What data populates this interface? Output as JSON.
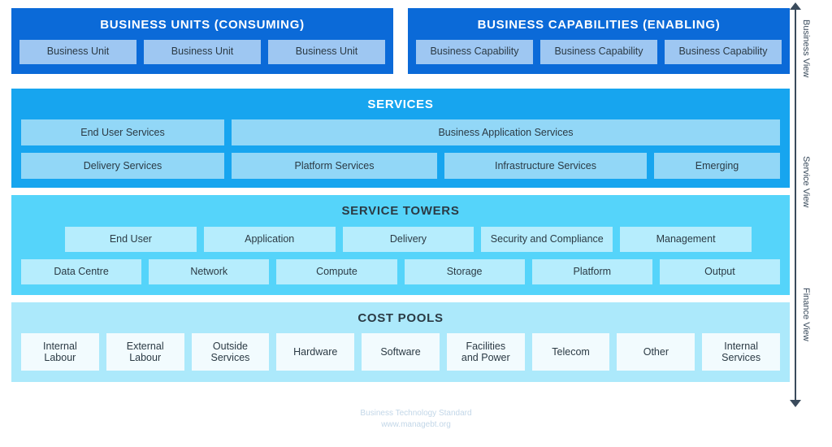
{
  "business_units": {
    "title": "BUSINESS UNITS (CONSUMING)",
    "tiles": [
      "Business Unit",
      "Business Unit",
      "Business Unit"
    ]
  },
  "business_capabilities": {
    "title": "BUSINESS CAPABILITIES (ENABLING)",
    "tiles": [
      "Business Capability",
      "Business Capability",
      "Business Capability"
    ]
  },
  "services": {
    "title": "SERVICES",
    "row1": [
      "End User Services",
      "Business Application Services"
    ],
    "row2": [
      "Delivery Services",
      "Platform Services",
      "Infrastructure Services",
      "Emerging"
    ]
  },
  "service_towers": {
    "title": "SERVICE TOWERS",
    "row1": [
      "End User",
      "Application",
      "Delivery",
      "Security and Compliance",
      "Management"
    ],
    "row2": [
      "Data Centre",
      "Network",
      "Compute",
      "Storage",
      "Platform",
      "Output"
    ]
  },
  "cost_pools": {
    "title": "COST POOLS",
    "tiles": [
      "Internal\nLabour",
      "External\nLabour",
      "Outside\nServices",
      "Hardware",
      "Software",
      "Facilities\nand Power",
      "Telecom",
      "Other",
      "Internal\nServices"
    ]
  },
  "axis": {
    "labels": [
      "Business View",
      "Service View",
      "Finance View"
    ]
  },
  "footer": {
    "line1": "Business Technology Standard",
    "line2": "www.managebt.org"
  },
  "colors": {
    "business_band": "#0b6ad8",
    "business_tile": "#9ec7f2",
    "services_band": "#17a5ef",
    "services_tile": "#92d7f7",
    "towers_band": "#55d4fa",
    "towers_tile": "#b6edfd",
    "pools_band": "#ace9fb",
    "pools_tile": "#f2fbfe",
    "axis": "#3a4b5c",
    "footer_text": "#c3d7e8"
  }
}
